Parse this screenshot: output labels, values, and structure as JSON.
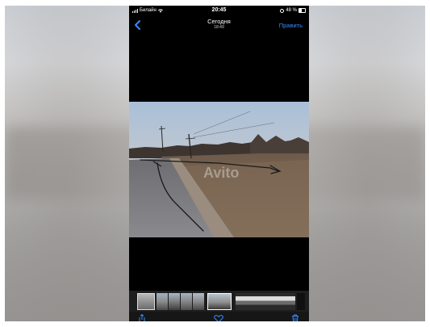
{
  "status_bar": {
    "carrier": "Билайн",
    "time": "20:45",
    "battery": "48 %",
    "battery_level": 0.48
  },
  "nav": {
    "title": "Сегодня",
    "subtitle": "18:49",
    "edit_label": "Править"
  },
  "watermark": "Avito",
  "colors": {
    "accent": "#3a8bff",
    "screen_background": "#000000"
  },
  "toolbar": {
    "share_icon": "share-icon",
    "favorite_icon": "heart-icon",
    "delete_icon": "trash-icon"
  }
}
